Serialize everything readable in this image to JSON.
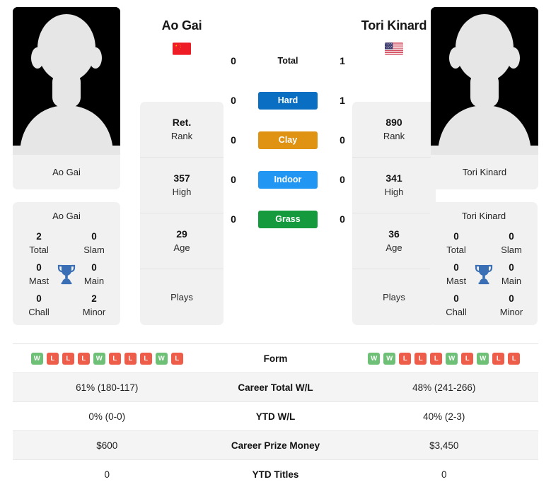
{
  "players": {
    "left": {
      "name": "Ao Gai",
      "photo_caption": "Ao Gai",
      "flag": "cn-flag-icon",
      "flag_colors": {
        "field": "#ee1c25",
        "star": "#ffde00"
      },
      "rank_card": [
        {
          "value": "Ret.",
          "label": "Rank"
        },
        {
          "value": "357",
          "label": "High"
        },
        {
          "value": "29",
          "label": "Age"
        },
        {
          "value": "",
          "label": "Plays"
        }
      ],
      "titles": {
        "heading": "Ao Gai",
        "total_value": "2",
        "total_label": "Total",
        "slam_value": "0",
        "slam_label": "Slam",
        "mast_value": "0",
        "mast_label": "Mast",
        "main_value": "0",
        "main_label": "Main",
        "chall_value": "0",
        "chall_label": "Chall",
        "minor_value": "2",
        "minor_label": "Minor"
      },
      "form": [
        "W",
        "L",
        "L",
        "L",
        "W",
        "L",
        "L",
        "L",
        "W",
        "L"
      ],
      "career_total_wl": "61% (180-117)",
      "ytd_wl": "0% (0-0)",
      "career_prize_money": "$600",
      "ytd_titles": "0"
    },
    "right": {
      "name": "Tori Kinard",
      "photo_caption": "Tori Kinard",
      "flag": "us-flag-icon",
      "flag_colors": {
        "stripe_red": "#cf4055",
        "canton": "#3c3b6e"
      },
      "rank_card": [
        {
          "value": "890",
          "label": "Rank"
        },
        {
          "value": "341",
          "label": "High"
        },
        {
          "value": "36",
          "label": "Age"
        },
        {
          "value": "",
          "label": "Plays"
        }
      ],
      "titles": {
        "heading": "Tori Kinard",
        "total_value": "0",
        "total_label": "Total",
        "slam_value": "0",
        "slam_label": "Slam",
        "mast_value": "0",
        "mast_label": "Mast",
        "main_value": "0",
        "main_label": "Main",
        "chall_value": "0",
        "chall_label": "Chall",
        "minor_value": "0",
        "minor_label": "Minor"
      },
      "form": [
        "W",
        "W",
        "L",
        "L",
        "L",
        "W",
        "L",
        "W",
        "L",
        "L"
      ],
      "career_total_wl": "48% (241-266)",
      "ytd_wl": "40% (2-3)",
      "career_prize_money": "$3,450",
      "ytd_titles": "0"
    }
  },
  "head_to_head": [
    {
      "label": "Total",
      "left": "0",
      "right": "1",
      "badge": false,
      "color": ""
    },
    {
      "label": "Hard",
      "left": "0",
      "right": "1",
      "badge": true,
      "color": "#0a6fc2"
    },
    {
      "label": "Clay",
      "left": "0",
      "right": "0",
      "badge": true,
      "color": "#e09212"
    },
    {
      "label": "Indoor",
      "left": "0",
      "right": "0",
      "badge": true,
      "color": "#2196f3"
    },
    {
      "label": "Grass",
      "left": "0",
      "right": "0",
      "badge": true,
      "color": "#159b3d"
    }
  ],
  "stats_table": [
    {
      "label": "Form",
      "left": "",
      "right": "",
      "type": "form"
    },
    {
      "label": "Career Total W/L",
      "left": "61% (180-117)",
      "right": "48% (241-266)",
      "type": "text"
    },
    {
      "label": "YTD W/L",
      "left": "0% (0-0)",
      "right": "40% (2-3)",
      "type": "text"
    },
    {
      "label": "Career Prize Money",
      "left": "$600",
      "right": "$3,450",
      "type": "text"
    },
    {
      "label": "YTD Titles",
      "left": "0",
      "right": "0",
      "type": "text"
    }
  ],
  "icons": {
    "trophy": "trophy-icon",
    "silhouette": "person-silhouette-icon"
  },
  "colors": {
    "win": "#6ec077",
    "loss": "#ee5d4a",
    "card_bg": "#f1f1f1",
    "row_alt": "#f4f4f4",
    "trophy": "#3a6fb5"
  }
}
